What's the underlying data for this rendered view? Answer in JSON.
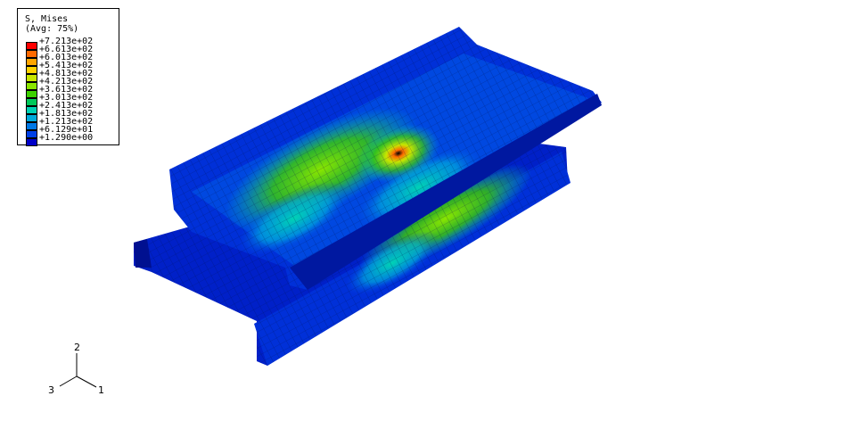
{
  "legend": {
    "title": "S, Mises",
    "subtitle": "(Avg: 75%)",
    "colors": [
      "#ff0000",
      "#ff6a00",
      "#ffa500",
      "#ffd200",
      "#c8e600",
      "#8ae600",
      "#3cd000",
      "#00c85a",
      "#00d2b4",
      "#00aadc",
      "#0078e6",
      "#0040e6",
      "#0000c8"
    ],
    "values": [
      "+7.213e+02",
      "+6.613e+02",
      "+6.013e+02",
      "+5.413e+02",
      "+4.813e+02",
      "+4.213e+02",
      "+3.613e+02",
      "+3.013e+02",
      "+2.413e+02",
      "+1.813e+02",
      "+1.213e+02",
      "+6.129e+01",
      "+1.290e+00"
    ]
  },
  "triad": {
    "axis_up": "2",
    "axis_left": "3",
    "axis_right": "1"
  }
}
